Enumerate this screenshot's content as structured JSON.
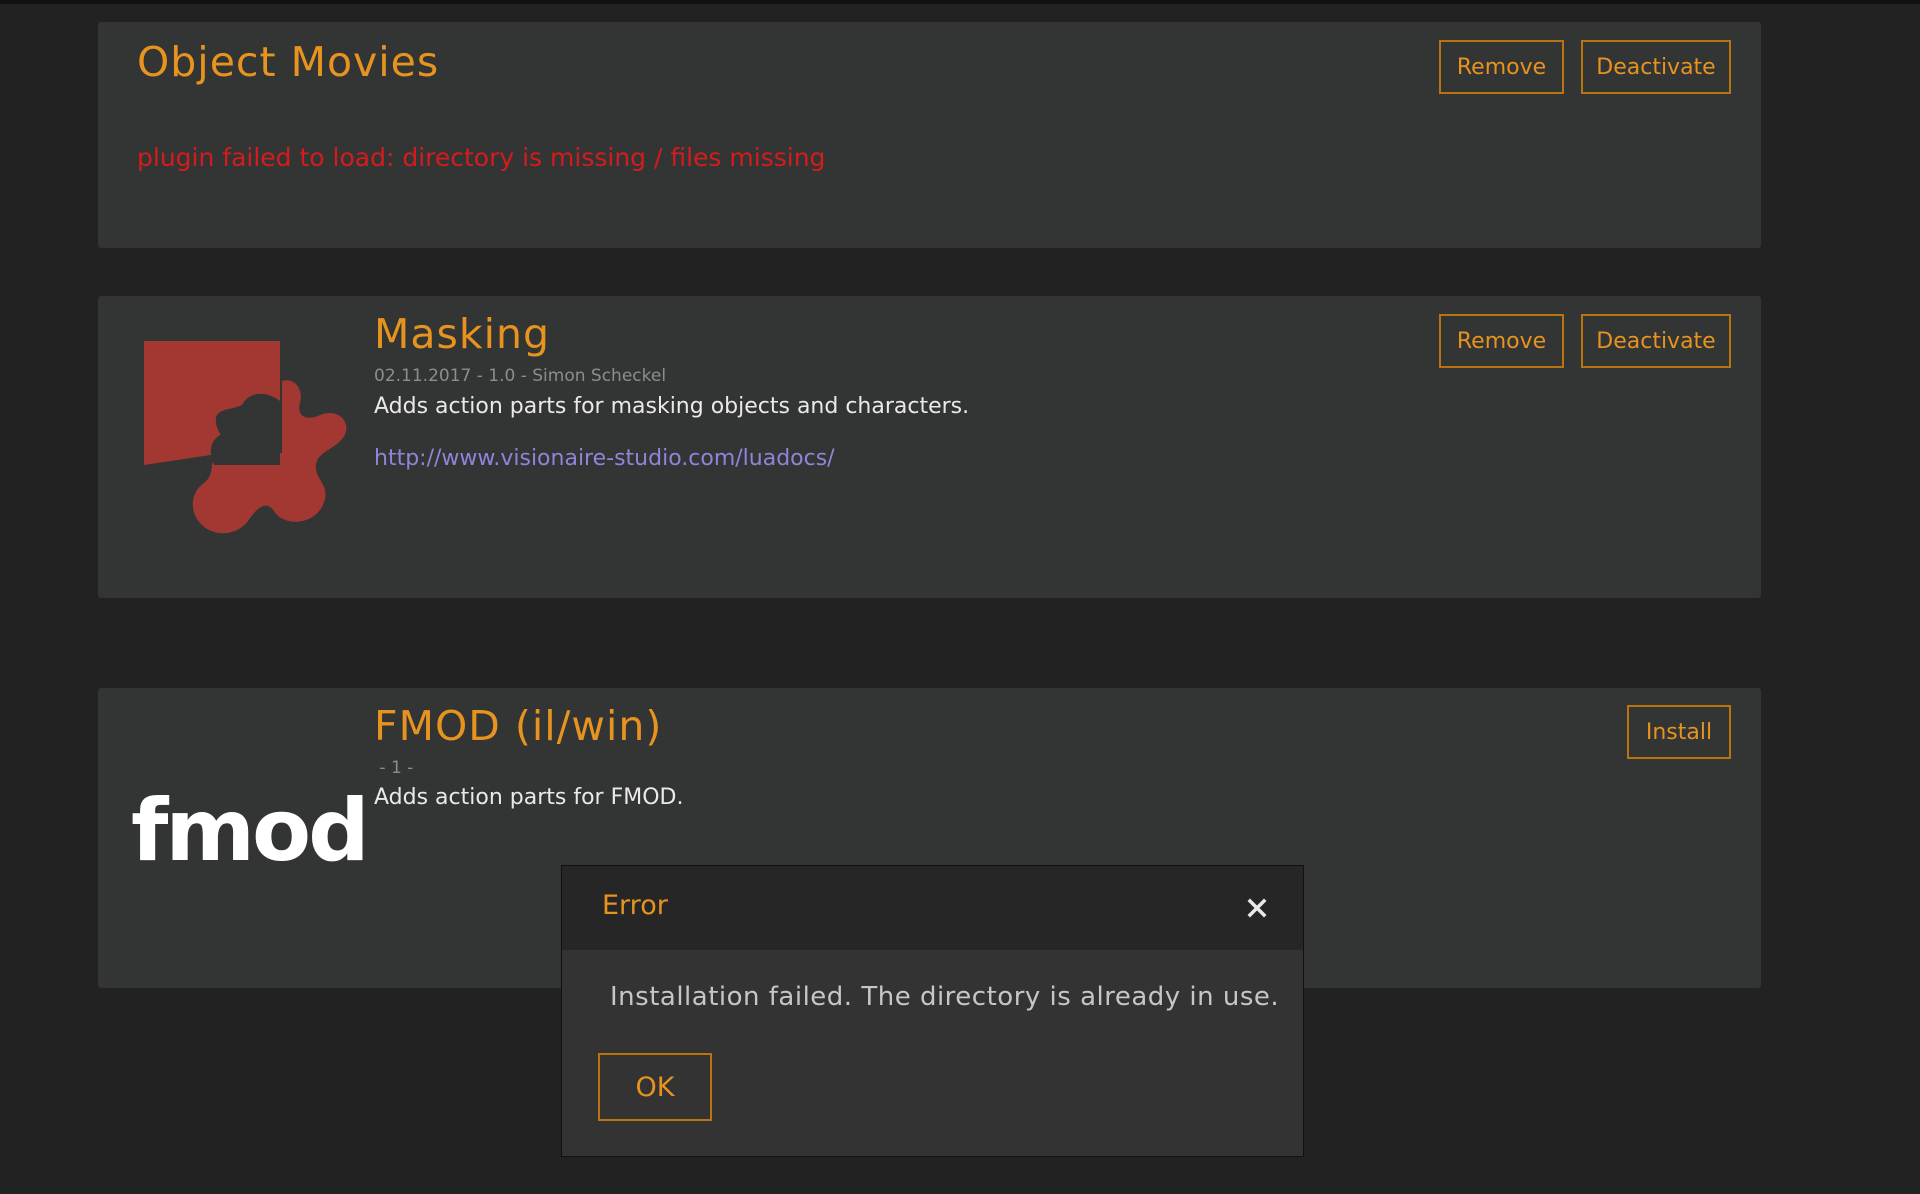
{
  "plugins": [
    {
      "title": "Object Movies",
      "error": "plugin failed to load: directory is missing / files missing",
      "remove_label": "Remove",
      "deactivate_label": "Deactivate"
    },
    {
      "title": "Masking",
      "meta": "02.11.2017 - 1.0 - Simon Scheckel",
      "description": "Adds action parts for masking objects and characters.",
      "link": "http://www.visionaire-studio.com/luadocs/",
      "remove_label": "Remove",
      "deactivate_label": "Deactivate",
      "logo_color": "#a23831"
    },
    {
      "title": "FMOD (il/win)",
      "meta": " - 1 - ",
      "description": "Adds action parts for FMOD.",
      "install_label": "Install",
      "logo_text": "fmod"
    }
  ],
  "dialog": {
    "title": "Error",
    "message": "Installation failed. The directory is already in use.",
    "ok_label": "OK",
    "close_icon": "close-icon"
  },
  "colors": {
    "accent": "#e6931f",
    "error": "#d41c1c",
    "link": "#8b86d8",
    "card_bg": "#333434",
    "page_bg": "#222222"
  }
}
